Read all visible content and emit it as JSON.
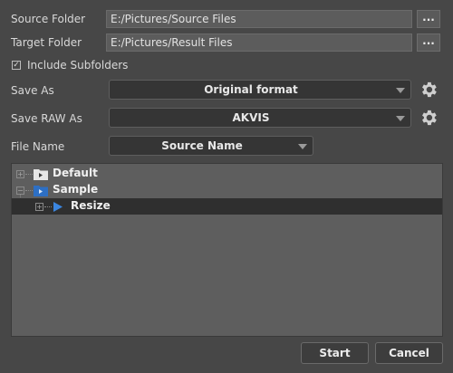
{
  "source_folder": {
    "label": "Source Folder",
    "value": "E:/Pictures/Source Files",
    "browse": "..."
  },
  "target_folder": {
    "label": "Target Folder",
    "value": "E:/Pictures/Result Files",
    "browse": "..."
  },
  "include_subfolders": {
    "label": "Include Subfolders",
    "checked": true,
    "mark": "✓"
  },
  "save_as": {
    "label": "Save As",
    "value": "Original format"
  },
  "save_raw_as": {
    "label": "Save RAW As",
    "value": "AKVIS"
  },
  "file_name": {
    "label": "File Name",
    "value": "Source Name"
  },
  "tree": {
    "items": [
      {
        "label": "Default",
        "expander": "+"
      },
      {
        "label": "Sample",
        "expander": "−"
      },
      {
        "label": "Resize",
        "expander": "+"
      }
    ]
  },
  "buttons": {
    "start": "Start",
    "cancel": "Cancel"
  }
}
